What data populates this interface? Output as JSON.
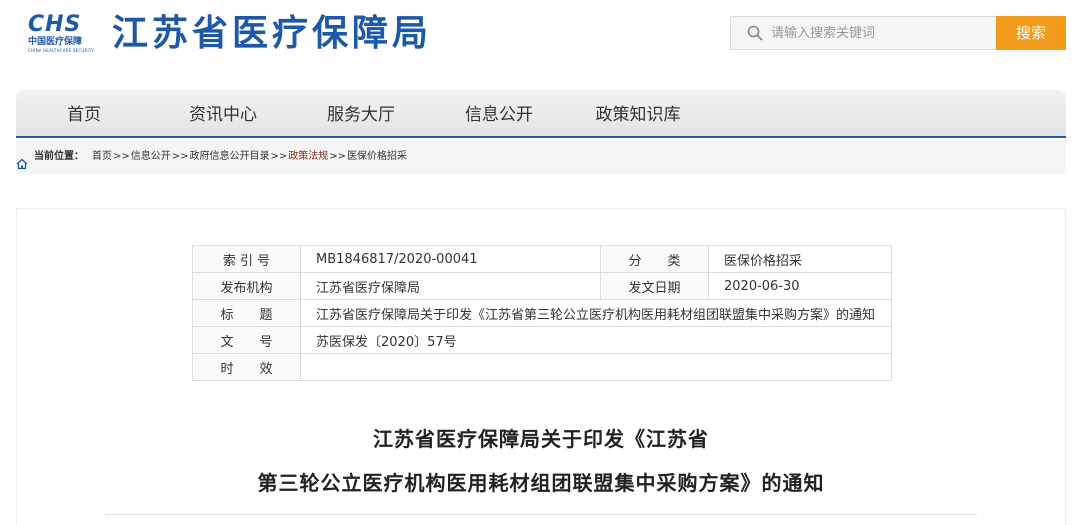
{
  "header": {
    "logo": {
      "mark_text": "CHS",
      "cn": "中国医疗保障",
      "en": "CHINA HEALTHCARE SECURITY"
    },
    "site_title": "江苏省医疗保障局",
    "search": {
      "placeholder": "请输入搜索关键词",
      "button_label": "搜索"
    }
  },
  "nav": {
    "items": [
      {
        "label": "首页"
      },
      {
        "label": "资讯中心"
      },
      {
        "label": "服务大厅"
      },
      {
        "label": "信息公开"
      },
      {
        "label": "政策知识库"
      }
    ]
  },
  "breadcrumb": {
    "label": "当前位置：",
    "sep": ">>",
    "items": [
      "首页",
      "信息公开",
      "政府信息公开目录",
      "政策法规",
      "医保价格招采"
    ]
  },
  "meta": {
    "index_label": "索 引 号",
    "index_value": "MB1846817/2020-00041",
    "category_label": "分　　类",
    "category_value": "医保价格招采",
    "publisher_label": "发布机构",
    "publisher_value": "江苏省医疗保障局",
    "date_label": "发文日期",
    "date_value": "2020-06-30",
    "title_label": "标　　题",
    "title_value": "江苏省医疗保障局关于印发《江苏省第三轮公立医疗机构医用耗材组团联盟集中采购方案》的通知",
    "docno_label": "文　　号",
    "docno_value": "苏医保发〔2020〕57号",
    "validity_label": "时　　效",
    "validity_value": ""
  },
  "document": {
    "title_line1": "江苏省医疗保障局关于印发《江苏省",
    "title_line2": "第三轮公立医疗机构医用耗材组团联盟集中采购方案》的通知"
  },
  "colors": {
    "brand": "#1e58a8",
    "search_button": "#f29b1c",
    "breadcrumb_active": "#8b2a1f"
  },
  "icons": {
    "search": "search-icon",
    "home": "home-icon"
  }
}
